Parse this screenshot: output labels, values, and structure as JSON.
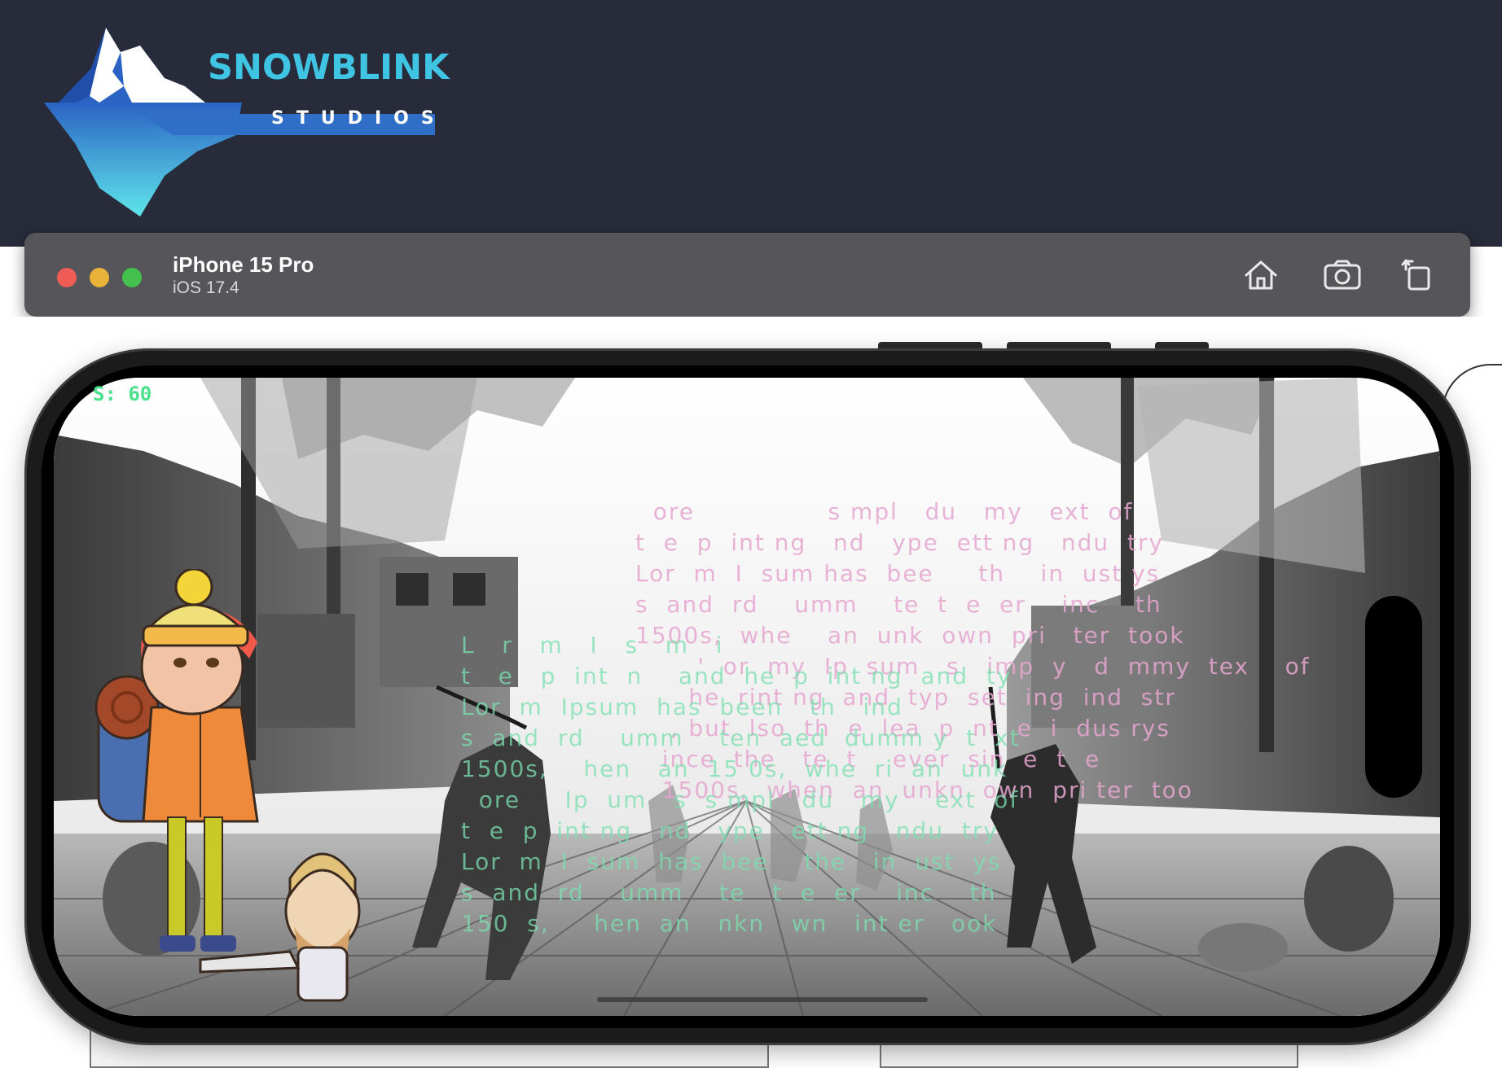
{
  "brand": {
    "name": "SNOWBLINK",
    "sub": "STUDIOS",
    "colors": {
      "band": "#282c3a",
      "cyan": "#3fc4e4",
      "blue": "#2f6fc7"
    }
  },
  "simulator": {
    "device_name": "iPhone 15 Pro",
    "os_version": "iOS 17.4",
    "toolbar": {
      "home_icon": "home-icon",
      "screenshot_icon": "camera-icon",
      "rotate_icon": "rotate-icon"
    }
  },
  "game": {
    "fps_label": "S: 60",
    "scene": "pirate-ship-sword-duel",
    "overlay_pink": "  ore               s mpl   du   my   ext  of\nt  e  p  int ng   nd   ype  ett ng   ndu  try\nLor  m  I  sum has  bee     th    in  ust ys\ns  and  rd    umm    te  t  e  er    inc    th\n1500s,  whe    an  unk  own  pri   ter  took\n       '  or  my  Ip  sum   s   imp  y   d  mmy  tex    of\n      he  rint ng  and  typ  set  ing  ind  str\n    , but  lso  th  e  lea  p  nt  e  i  dus rys\n   ince  the   te  t    ever  sin  e  t  e\n   1500s,  when  an  unkn  own  pri ter  too",
    "overlay_green": "L   r   m   I   s   m   i\nt   e   p  int  n    and  he  p  int ng  and  ty\nLor  m  Ipsum  has  been   th   ind\ns  and  rd    umm    ten  aed  dumm y  t  xt\n1500s,    hen   an  15 0s,  whe  ri  an  unk\n  ore     Ip  um   s  s mpl   du   my    ext  of\nt  e  p  int ng   nd   ype   ett ng   ndu  try\nLor  m  I  sum  has  bee    the   in  ust  ys\ns  and  rd    umm    te   t  e  er    inc    th\n150  s,     hen  an   nkn   wn   int er   ook"
  }
}
